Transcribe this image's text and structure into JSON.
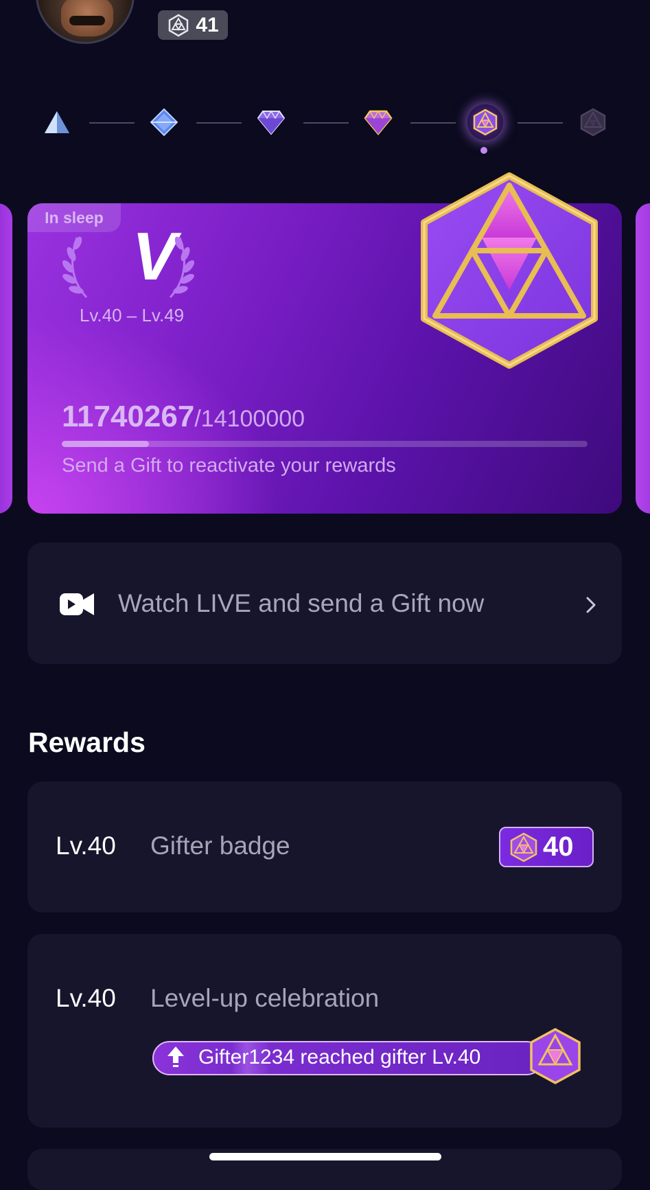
{
  "header": {
    "gifter_level": "41"
  },
  "card": {
    "status_tag": "In sleep",
    "tier": "V",
    "level_range": "Lv.40 – Lv.49",
    "current_points": "11740267",
    "target_points": "/14100000",
    "progress_fraction": 0.166,
    "hint": "Send a Gift to reactivate your rewards"
  },
  "watch_live": {
    "label": "Watch LIVE and send a Gift now"
  },
  "rewards": {
    "title": "Rewards",
    "items": [
      {
        "level": "Lv.40",
        "name": "Gifter badge",
        "badge_value": "40"
      },
      {
        "level": "Lv.40",
        "name": "Level-up celebration",
        "banner_text": "Gifter1234 reached gifter Lv.40"
      }
    ]
  },
  "colors": {
    "background": "#0b0a1e",
    "card_purple": "#7a1ec6",
    "accent_gold": "#e3b84a",
    "panel": "#17152c"
  }
}
